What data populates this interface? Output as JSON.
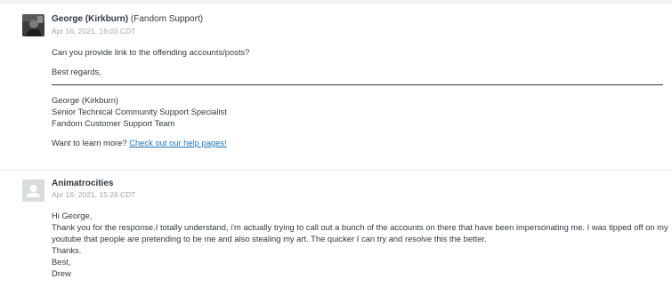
{
  "comments": [
    {
      "author": "George (Kirkburn)",
      "organization": "(Fandom Support)",
      "avatar_icon": "user-photo-avatar",
      "timestamp": "Apr 16, 2021, 16:03 CDT",
      "question": "Can you provide link to the offending accounts/posts?",
      "closing": "Best regards,",
      "signature": {
        "name": "George (Kirkburn)",
        "title": "Senior Technical Community Support Specialist",
        "team": "Fandom Customer Support Team"
      },
      "learn_more_prefix": "Want to learn more?",
      "learn_more_link": "Check out our help pages!"
    },
    {
      "author": "Animatrocities",
      "avatar_icon": "default-user-icon",
      "timestamp": "Apr 16, 2021, 15:26 CDT",
      "lines": [
        "Hi George,",
        "Thank you for the response.I totally understand, i'm actually trying to call out a bunch of the accounts on there that have been impersonating me. I was tipped off on my",
        "youtube that people are pretending to be me and also stealing my art. The quicker I can try and resolve this the better.",
        "Thanks.",
        "Best,",
        "Drew"
      ]
    }
  ],
  "colors": {
    "text": "#2f3941",
    "muted": "#a0a6ad",
    "link": "#1f73b7",
    "default_avatar": "#d8dcde"
  }
}
